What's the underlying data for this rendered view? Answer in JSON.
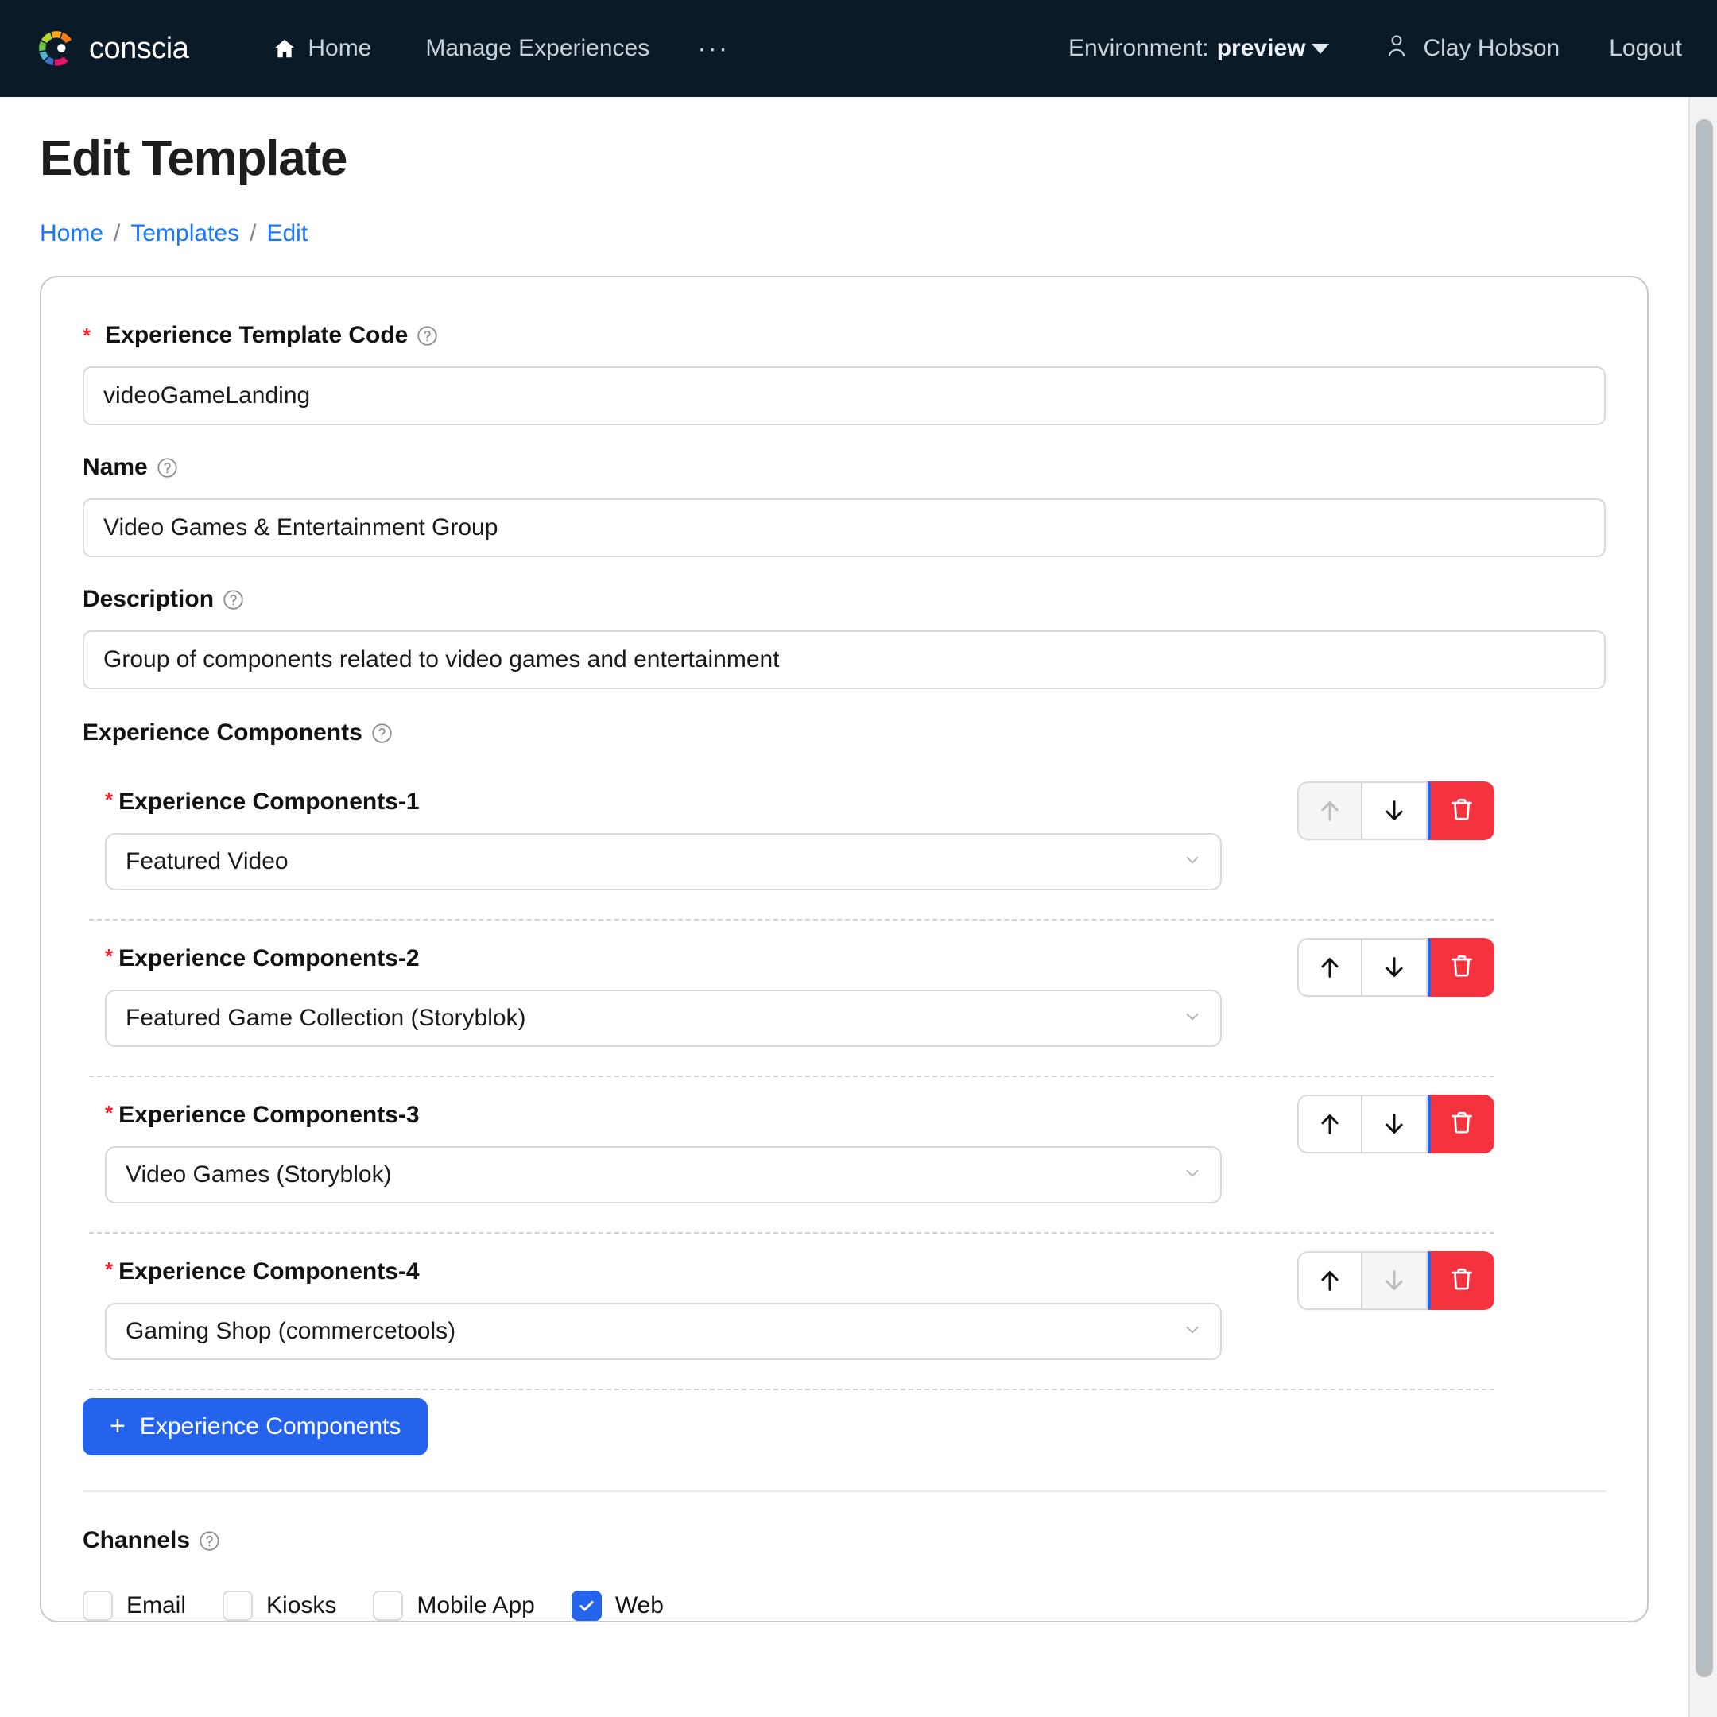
{
  "topnav": {
    "brand": "conscia",
    "links": [
      {
        "label": "Home",
        "icon": "home-icon"
      },
      {
        "label": "Manage Experiences",
        "icon": ""
      }
    ],
    "overflow": "···",
    "environment_label": "Environment:",
    "environment_value": "preview",
    "user_name": "Clay Hobson",
    "logout": "Logout",
    "bg_color": "#0b1a27"
  },
  "page": {
    "title": "Edit Template",
    "breadcrumb": [
      {
        "label": "Home"
      },
      {
        "label": "Templates"
      },
      {
        "label": "Edit"
      }
    ],
    "breadcrumb_separator": "/",
    "link_color": "#1677ff"
  },
  "form": {
    "template_code": {
      "label": "Experience Template Code",
      "required": true,
      "value": "videoGameLanding",
      "placeholder": ""
    },
    "name": {
      "label": "Name",
      "required": false,
      "value": "Video Games & Entertainment Group",
      "placeholder": ""
    },
    "description": {
      "label": "Description",
      "required": false,
      "value": "Group of components related to video games and entertainment",
      "placeholder": ""
    },
    "components_section": {
      "label": "Experience Components",
      "add_button": "Experience Components",
      "add_icon": "plus-icon",
      "items": [
        {
          "label": "Experience Components-1",
          "value": "Featured Video",
          "move_up_enabled": false,
          "move_down_enabled": true
        },
        {
          "label": "Experience Components-2",
          "value": "Featured Game Collection (Storyblok)",
          "move_up_enabled": true,
          "move_down_enabled": true
        },
        {
          "label": "Experience Components-3",
          "value": "Video Games (Storyblok)",
          "move_up_enabled": true,
          "move_down_enabled": true
        },
        {
          "label": "Experience Components-4",
          "value": "Gaming Shop (commercetools)",
          "move_up_enabled": true,
          "move_down_enabled": false
        }
      ]
    },
    "channels": {
      "label": "Channels",
      "options": [
        {
          "label": "Email",
          "checked": false
        },
        {
          "label": "Kiosks",
          "checked": false
        },
        {
          "label": "Mobile App",
          "checked": false
        },
        {
          "label": "Web",
          "checked": true
        }
      ]
    }
  },
  "colors": {
    "primary": "#2463eb",
    "danger": "#f5333f",
    "required_star": "#f5222d",
    "nav_bg": "#0b1a27"
  }
}
